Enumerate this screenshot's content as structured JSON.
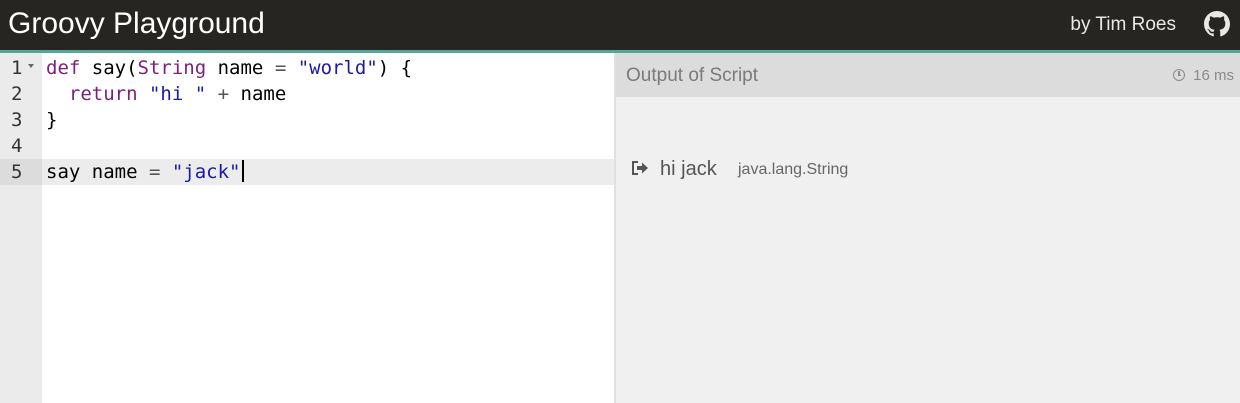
{
  "header": {
    "title": "Groovy Playground",
    "author": "by Tim Roes",
    "github_icon": "github-icon"
  },
  "editor": {
    "line_numbers": [
      "1",
      "2",
      "3",
      "4",
      "5"
    ],
    "active_line": 5,
    "lines": [
      [
        {
          "t": "def",
          "c": "kw"
        },
        {
          "t": " say(",
          "c": ""
        },
        {
          "t": "String",
          "c": "kw"
        },
        {
          "t": " name ",
          "c": ""
        },
        {
          "t": "=",
          "c": "op"
        },
        {
          "t": " ",
          "c": ""
        },
        {
          "t": "\"world\"",
          "c": "str"
        },
        {
          "t": ") {",
          "c": ""
        }
      ],
      [
        {
          "t": "  return ",
          "c": "kw"
        },
        {
          "t": "\"hi \"",
          "c": "str"
        },
        {
          "t": " ",
          "c": ""
        },
        {
          "t": "+",
          "c": "op"
        },
        {
          "t": " name",
          "c": ""
        }
      ],
      [
        {
          "t": "}",
          "c": ""
        }
      ],
      [],
      [
        {
          "t": "say name ",
          "c": ""
        },
        {
          "t": "=",
          "c": "op"
        },
        {
          "t": " ",
          "c": ""
        },
        {
          "t": "\"jack\"",
          "c": "str"
        }
      ]
    ]
  },
  "output": {
    "title": "Output of Script",
    "time": "16 ms",
    "time_icon": "clock-icon",
    "result": {
      "icon": "sign-out-icon",
      "value": "hi jack",
      "type": "java.lang.String"
    }
  },
  "colors": {
    "header_bg": "#262521",
    "header_accent": "#4fa89a",
    "keyword": "#7a1f7a",
    "string": "#1a1aa6"
  }
}
